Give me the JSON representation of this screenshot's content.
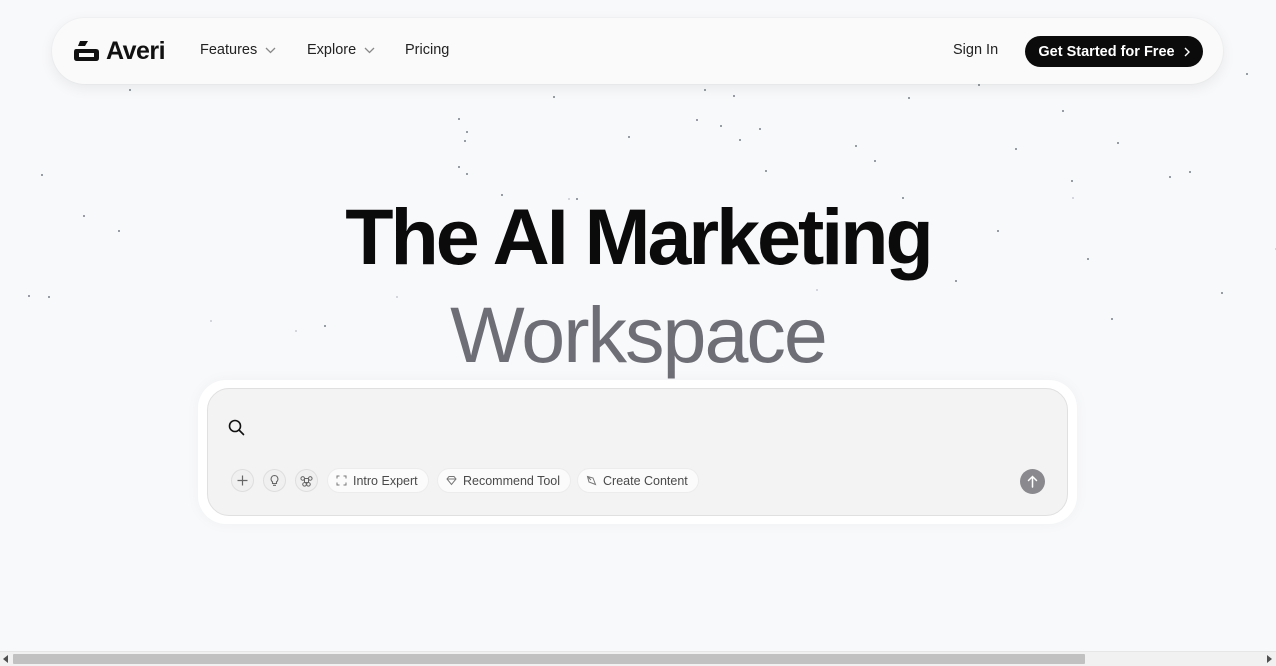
{
  "brand": {
    "name": "Averi",
    "logo_icon": "averi-logo-icon"
  },
  "nav": {
    "items": [
      {
        "label": "Features",
        "has_dropdown": true
      },
      {
        "label": "Explore",
        "has_dropdown": true
      },
      {
        "label": "Pricing",
        "has_dropdown": false
      }
    ],
    "sign_in": "Sign In",
    "cta": "Get Started for Free"
  },
  "hero": {
    "title": "The AI Marketing",
    "subtitle": "Workspace"
  },
  "search": {
    "placeholder": "",
    "value": "",
    "icon": "search-icon",
    "tools": [
      {
        "icon": "plus-icon"
      },
      {
        "icon": "lightbulb-icon"
      },
      {
        "icon": "command-icon"
      }
    ],
    "chips": [
      {
        "label": "Intro Expert",
        "icon": "scan-icon"
      },
      {
        "label": "Recommend Tool",
        "icon": "gem-icon"
      },
      {
        "label": "Create Content",
        "icon": "pen-icon"
      }
    ],
    "send_icon": "arrow-up-icon"
  },
  "colors": {
    "background": "#f8f9fb",
    "cta_background": "#0b0b0c",
    "subtitle": "#6e6e76",
    "send_button": "#8a8a8e"
  }
}
